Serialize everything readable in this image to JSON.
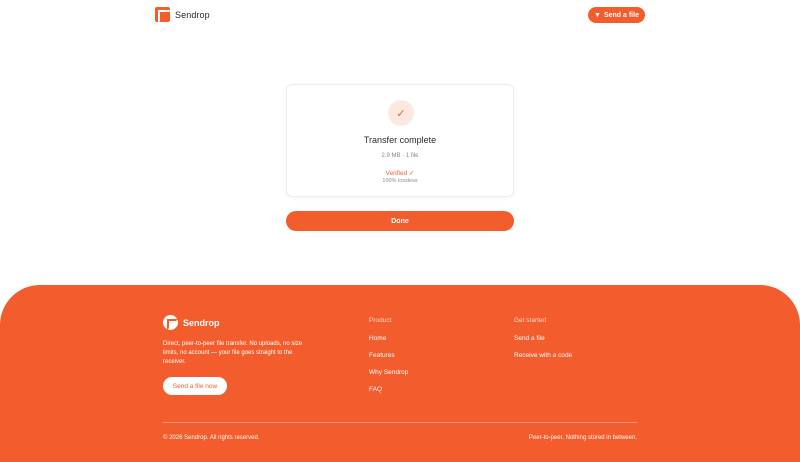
{
  "header": {
    "brand_name": "Sendrop",
    "send_button_label": "Send a file"
  },
  "card": {
    "title": "Transfer complete",
    "subtitle": "2.9 MB · 1 file",
    "verified": "Verified ✓",
    "lossless": "100% lossless"
  },
  "done_label": "Done",
  "footer": {
    "brand_name": "Sendrop",
    "description": "Direct, peer-to-peer file transfer. No uploads, no size limits, no account — your file goes straight to the receiver.",
    "cta_label": "Send a file now",
    "product": {
      "heading": "Product",
      "links": [
        "Home",
        "Features",
        "Why Sendrop",
        "FAQ"
      ]
    },
    "get_started": {
      "heading": "Get started",
      "links": [
        "Send a file",
        "Receive with a code"
      ]
    },
    "copyright": "© 2026 Sendrop. All rights reserved.",
    "tagline": "Peer-to-peer. Nothing stored in between."
  },
  "colors": {
    "accent": "#f35c2c",
    "accent_soft": "#fde8e0"
  },
  "icons": {
    "brand": "sendrop-logo-icon",
    "send": "filter-funnel-icon",
    "check": "checkmark-icon"
  }
}
